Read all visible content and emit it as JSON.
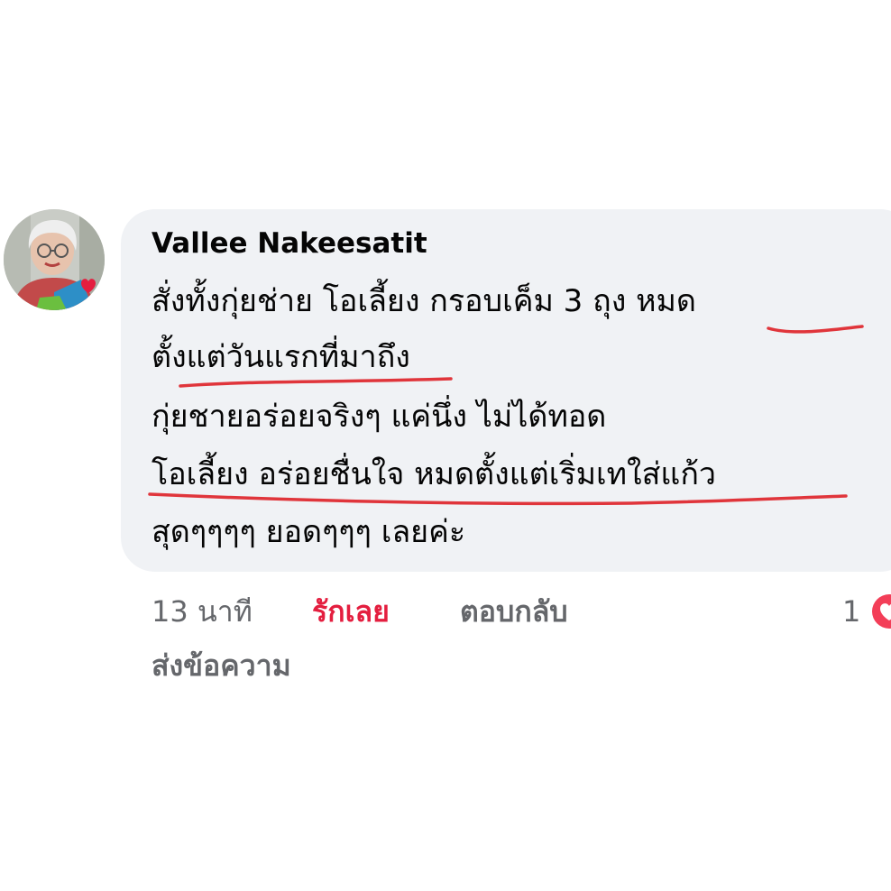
{
  "comment": {
    "author": "Vallee Nakeesatit",
    "lines": [
      "สั่งทั้งกุ่ยช่าย โอเลี้ยง กรอบเค็ม 3 ถุง หมด",
      "ตั้งแต่วันแรกที่มาถึง",
      "กุ่ยชายอร่อยจริงๆ แค่นึ่ง ไม่ได้ทอด",
      "โอเลี้ยง อร่อยชื่นใจ หมดตั้งแต่เริ่มเทใส่แก้ว",
      "สุดๆๆๆๆ ยอดๆๆๆ เลยค่ะ"
    ]
  },
  "actions": {
    "time": "13 นาที",
    "like": "รักเลย",
    "reply": "ตอบกลับ",
    "message": "ส่งข้อความ"
  },
  "reactions": {
    "count": "1",
    "icon": "love-reaction-icon"
  },
  "colors": {
    "bubble": "#f0f2f5",
    "like_active": "#e41e3f",
    "underline": "#e0353b",
    "muted": "#65676b"
  }
}
